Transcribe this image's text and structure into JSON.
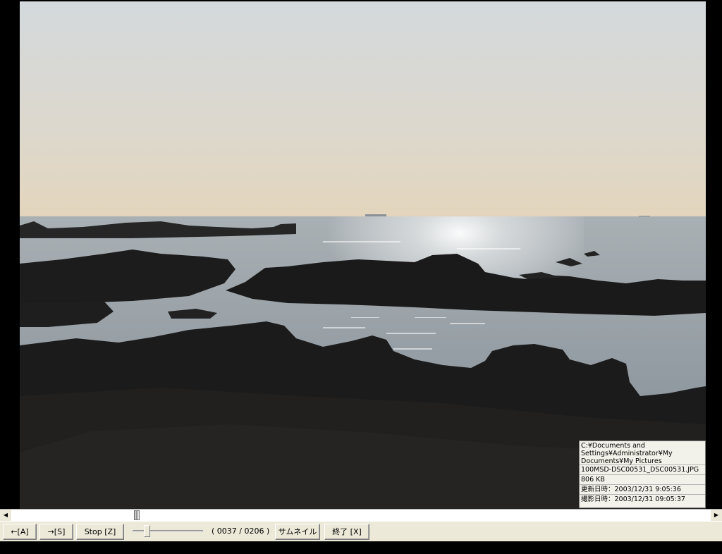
{
  "info": {
    "path": "C:¥Documents and Settings¥Administrator¥My Documents¥My Pictures",
    "filename": "100MSD-DSC00531_DSC00531.JPG",
    "size": "806 KB",
    "modified": "更新日時：2003/12/31 9:05:36",
    "taken": "撮影日時：2003/12/31 09:05:37"
  },
  "scrollbar": {
    "left_arrow": "◀",
    "right_arrow": "▶"
  },
  "toolbar": {
    "prev_label": "←[A]",
    "next_label": "→[S]",
    "stop_label": "Stop [Z]",
    "counter": "( 0037 / 0206 )",
    "thumbnail_label": "サムネイル[C]",
    "exit_label": "終了 [X]"
  },
  "colors": {
    "sky_top": "#d5dadc",
    "sky_horizon": "#e4d7c0",
    "water": "#9aa5ad",
    "rock": "#1e1d1d"
  }
}
